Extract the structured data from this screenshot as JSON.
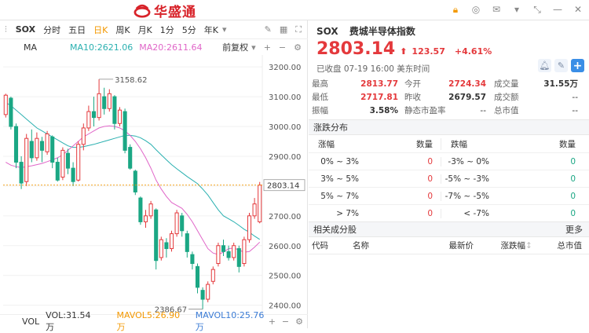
{
  "brand": {
    "name": "华盛通",
    "color": "#d8232a"
  },
  "window_icons": [
    "lock-icon",
    "headset-icon",
    "mail-icon",
    "shirt-icon",
    "collapse-icon",
    "minimize-icon",
    "close-icon"
  ],
  "toolbar": {
    "symbol": "SOX",
    "periods": [
      "分时",
      "五日",
      "日K",
      "周K",
      "月K",
      "1分",
      "5分",
      "年K"
    ],
    "active_period": "日K",
    "adjust": "前复权"
  },
  "ma_line": {
    "ma": "MA",
    "ma10": "MA10:2621.06",
    "ma20": "MA20:2611.64"
  },
  "vol_line": {
    "vol": "VOL",
    "vol_value": "VOL:31.54万",
    "mavol5": "MAVOL5:26.90万",
    "mavol10": "MAVOL10:25.76万"
  },
  "chart_data": {
    "type": "candlestick",
    "y_ticks": [
      3200,
      3100,
      3000,
      2900,
      2800,
      2700,
      2600,
      2500,
      2400
    ],
    "ylim": [
      2370,
      3240
    ],
    "current_price_label": "2803.14",
    "high_label": "3158.62",
    "low_label": "2386.67",
    "candles": [
      {
        "o": 3040,
        "c": 3105,
        "h": 3110,
        "l": 3030
      },
      {
        "o": 3095,
        "c": 3000,
        "h": 3100,
        "l": 2990
      },
      {
        "o": 3000,
        "c": 2880,
        "h": 3010,
        "l": 2860
      },
      {
        "o": 2880,
        "c": 2810,
        "h": 2900,
        "l": 2790
      },
      {
        "o": 2815,
        "c": 2960,
        "h": 2975,
        "l": 2800
      },
      {
        "o": 2950,
        "c": 2895,
        "h": 2990,
        "l": 2880
      },
      {
        "o": 2895,
        "c": 2960,
        "h": 2980,
        "l": 2885
      },
      {
        "o": 2950,
        "c": 2920,
        "h": 2965,
        "l": 2880
      },
      {
        "o": 2915,
        "c": 2975,
        "h": 2985,
        "l": 2905
      },
      {
        "o": 2965,
        "c": 2880,
        "h": 2970,
        "l": 2860
      },
      {
        "o": 2880,
        "c": 2820,
        "h": 2895,
        "l": 2815
      },
      {
        "o": 2830,
        "c": 2920,
        "h": 2930,
        "l": 2820
      },
      {
        "o": 2910,
        "c": 2860,
        "h": 2925,
        "l": 2840
      },
      {
        "o": 2860,
        "c": 2815,
        "h": 2880,
        "l": 2800
      },
      {
        "o": 2820,
        "c": 2940,
        "h": 2950,
        "l": 2815
      },
      {
        "o": 2940,
        "c": 2995,
        "h": 3010,
        "l": 2920
      },
      {
        "o": 2995,
        "c": 3050,
        "h": 3070,
        "l": 2985
      },
      {
        "o": 3050,
        "c": 3030,
        "h": 3100,
        "l": 3000
      },
      {
        "o": 3030,
        "c": 3110,
        "h": 3158.62,
        "l": 3020
      },
      {
        "o": 3100,
        "c": 3060,
        "h": 3130,
        "l": 3040
      },
      {
        "o": 3060,
        "c": 3110,
        "h": 3125,
        "l": 3050
      },
      {
        "o": 3100,
        "c": 3010,
        "h": 3105,
        "l": 2990
      },
      {
        "o": 3010,
        "c": 3055,
        "h": 3065,
        "l": 3000
      },
      {
        "o": 3050,
        "c": 2920,
        "h": 3060,
        "l": 2910
      },
      {
        "o": 2930,
        "c": 2860,
        "h": 2940,
        "l": 2855
      },
      {
        "o": 2850,
        "c": 2780,
        "h": 2855,
        "l": 2770
      },
      {
        "o": 2760,
        "c": 2680,
        "h": 2765,
        "l": 2670
      },
      {
        "o": 2680,
        "c": 2700,
        "h": 2720,
        "l": 2660
      },
      {
        "o": 2700,
        "c": 2740,
        "h": 2750,
        "l": 2690
      },
      {
        "o": 2720,
        "c": 2550,
        "h": 2725,
        "l": 2520
      },
      {
        "o": 2560,
        "c": 2620,
        "h": 2630,
        "l": 2550
      },
      {
        "o": 2610,
        "c": 2590,
        "h": 2625,
        "l": 2560
      },
      {
        "o": 2590,
        "c": 2640,
        "h": 2650,
        "l": 2580
      },
      {
        "o": 2640,
        "c": 2710,
        "h": 2720,
        "l": 2630
      },
      {
        "o": 2700,
        "c": 2650,
        "h": 2710,
        "l": 2630
      },
      {
        "o": 2640,
        "c": 2580,
        "h": 2650,
        "l": 2560
      },
      {
        "o": 2570,
        "c": 2540,
        "h": 2580,
        "l": 2520
      },
      {
        "o": 2530,
        "c": 2460,
        "h": 2540,
        "l": 2440
      },
      {
        "o": 2450,
        "c": 2420,
        "h": 2460,
        "l": 2386.67
      },
      {
        "o": 2420,
        "c": 2470,
        "h": 2480,
        "l": 2410
      },
      {
        "o": 2480,
        "c": 2520,
        "h": 2530,
        "l": 2470
      },
      {
        "o": 2540,
        "c": 2600,
        "h": 2610,
        "l": 2530
      },
      {
        "o": 2600,
        "c": 2580,
        "h": 2620,
        "l": 2565
      },
      {
        "o": 2580,
        "c": 2560,
        "h": 2600,
        "l": 2550
      },
      {
        "o": 2560,
        "c": 2600,
        "h": 2610,
        "l": 2550
      },
      {
        "o": 2590,
        "c": 2530,
        "h": 2600,
        "l": 2510
      },
      {
        "o": 2540,
        "c": 2620,
        "h": 2630,
        "l": 2530
      },
      {
        "o": 2620,
        "c": 2700,
        "h": 2710,
        "l": 2610
      },
      {
        "o": 2700,
        "c": 2740,
        "h": 2760,
        "l": 2690
      },
      {
        "o": 2680,
        "c": 2803.14,
        "h": 2813.77,
        "l": 2675
      }
    ],
    "ma10": [
      3080,
      3070,
      3055,
      3040,
      3025,
      3010,
      2995,
      2985,
      2975,
      2965,
      2955,
      2945,
      2935,
      2930,
      2930,
      2932,
      2936,
      2940,
      2945,
      2950,
      2955,
      2960,
      2965,
      2970,
      2970,
      2968,
      2962,
      2952,
      2940,
      2922,
      2905,
      2888,
      2872,
      2858,
      2845,
      2832,
      2820,
      2808,
      2790,
      2770,
      2745,
      2720,
      2700,
      2690,
      2680,
      2668,
      2655,
      2645,
      2632,
      2621.06
    ],
    "ma20": [
      2880,
      2870,
      2865,
      2862,
      2865,
      2868,
      2872,
      2876,
      2882,
      2888,
      2895,
      2905,
      2920,
      2935,
      2950,
      2965,
      2975,
      2985,
      2995,
      3000,
      3002,
      3000,
      2995,
      2985,
      2970,
      2950,
      2925,
      2895,
      2860,
      2820,
      2790,
      2765,
      2745,
      2735,
      2725,
      2705,
      2680,
      2650,
      2620,
      2590,
      2575,
      2570,
      2578,
      2590,
      2592,
      2585,
      2578,
      2580,
      2595,
      2611.64
    ]
  },
  "quote": {
    "symbol": "SOX",
    "name": "费城半导体指数",
    "price": "2803.14",
    "change": "123.57",
    "change_pct": "+4.61%",
    "status": "已收盘 07-19 16:00 美东时间",
    "icons": [
      "bell-icon",
      "edit-icon",
      "add-icon"
    ]
  },
  "stats": [
    {
      "l1": "最高",
      "v1": "2813.77",
      "l2": "今开",
      "v2": "2724.34",
      "l3": "成交量",
      "v3": "31.55万"
    },
    {
      "l1": "最低",
      "v1": "2717.81",
      "l2": "昨收",
      "v2": "2679.57",
      "l3": "成交额",
      "v3": "--"
    },
    {
      "l1": "振幅",
      "v1": "3.58%",
      "l2": "静态市盈率",
      "v2": "--",
      "l3": "总市值",
      "v3": "--"
    }
  ],
  "distribution": {
    "title": "涨跌分布",
    "headers": [
      "涨幅",
      "数量",
      "跌幅",
      "数量"
    ],
    "rows": [
      {
        "up": "0% ~ 3%",
        "upn": "0",
        "down": "-3% ~ 0%",
        "downn": "0"
      },
      {
        "up": "3% ~ 5%",
        "upn": "0",
        "down": "-5% ~ -3%",
        "downn": "0"
      },
      {
        "up": "5% ~ 7%",
        "upn": "0",
        "down": "-7% ~ -5%",
        "downn": "0"
      },
      {
        "up": "> 7%",
        "upn": "0",
        "down": "< -7%",
        "downn": "0"
      }
    ]
  },
  "constituents": {
    "title": "相关成分股",
    "more": "更多",
    "headers": [
      "代码",
      "名称",
      "最新价",
      "涨跌幅",
      "总市值"
    ]
  },
  "colors": {
    "up": "#e4393c",
    "down": "#1ba784",
    "ma10": "#2ab0b0",
    "ma20": "#e066c8",
    "accent": "#f39800"
  }
}
